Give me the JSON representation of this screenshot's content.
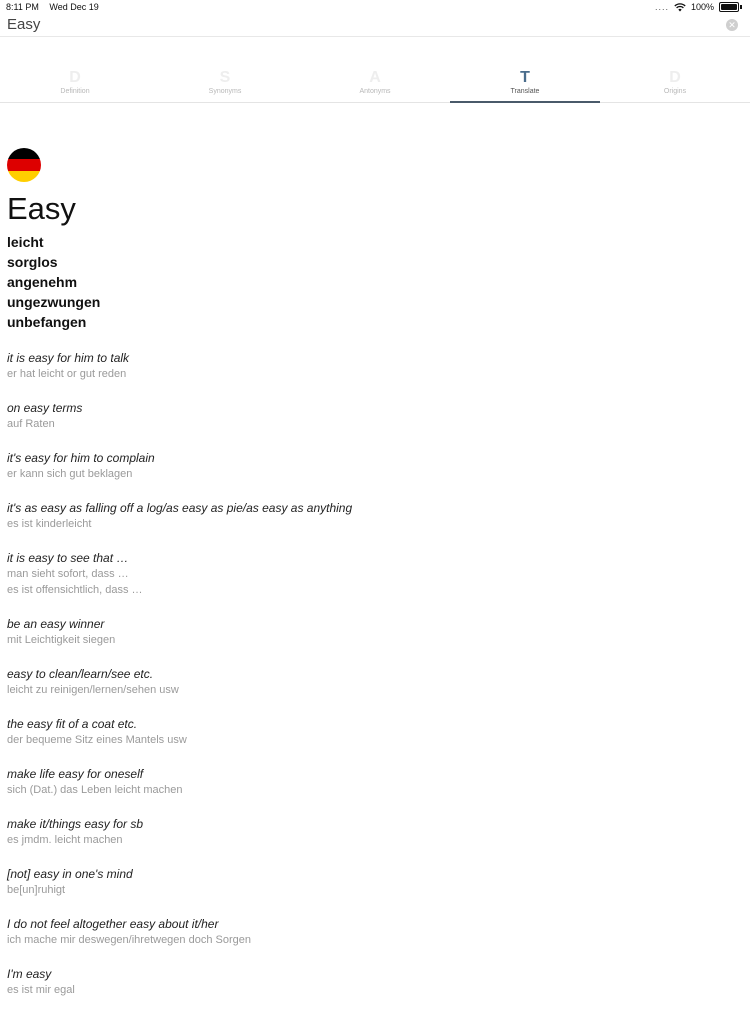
{
  "status_bar": {
    "time": "8:11 PM",
    "date": "Wed Dec 19",
    "signal": "....",
    "battery": "100%"
  },
  "search": {
    "value": "Easy"
  },
  "tabs": [
    {
      "icon": "D",
      "label": "Definition"
    },
    {
      "icon": "S",
      "label": "Synonyms"
    },
    {
      "icon": "A",
      "label": "Antonyms"
    },
    {
      "icon": "T",
      "label": "Translate"
    },
    {
      "icon": "D",
      "label": "Origins"
    }
  ],
  "active_tab": "Translate",
  "entry": {
    "headword": "Easy",
    "flag": "germany-flag-icon",
    "translations": [
      "leicht",
      "sorglos",
      "angenehm",
      "ungezwungen",
      "unbefangen"
    ],
    "examples": [
      {
        "phrase": "it is easy for him to talk",
        "translations": [
          "er hat leicht or gut reden"
        ]
      },
      {
        "phrase": "on easy terms",
        "translations": [
          "auf Raten"
        ]
      },
      {
        "phrase": "it's easy for him to complain",
        "translations": [
          "er kann sich gut beklagen"
        ]
      },
      {
        "phrase": "it's as easy as falling off a log/as easy as pie/as easy as anything",
        "translations": [
          "es ist kinderleicht"
        ]
      },
      {
        "phrase": "it is easy to see that …",
        "translations": [
          "man sieht sofort, dass …",
          "es ist offensichtlich, dass …"
        ]
      },
      {
        "phrase": "be an easy winner",
        "translations": [
          "mit Leichtigkeit siegen"
        ]
      },
      {
        "phrase": "easy to clean/learn/see etc.",
        "translations": [
          "leicht zu reinigen/lernen/sehen usw"
        ]
      },
      {
        "phrase": "the easy fit of a coat etc.",
        "translations": [
          "der bequeme Sitz eines Mantels usw"
        ]
      },
      {
        "phrase": "make life easy for oneself",
        "translations": [
          "sich (Dat.) das Leben leicht machen"
        ]
      },
      {
        "phrase": "make it/things easy for sb",
        "translations": [
          "es jmdm. leicht machen"
        ]
      },
      {
        "phrase": "[not] easy in one's mind",
        "translations": [
          "be[un]ruhigt"
        ]
      },
      {
        "phrase": "I do not feel altogether easy about it/her",
        "translations": [
          "ich mache mir deswegen/ihretwegen doch Sorgen"
        ]
      },
      {
        "phrase": "I'm easy",
        "translations": [
          "es ist mir egal"
        ]
      }
    ]
  }
}
